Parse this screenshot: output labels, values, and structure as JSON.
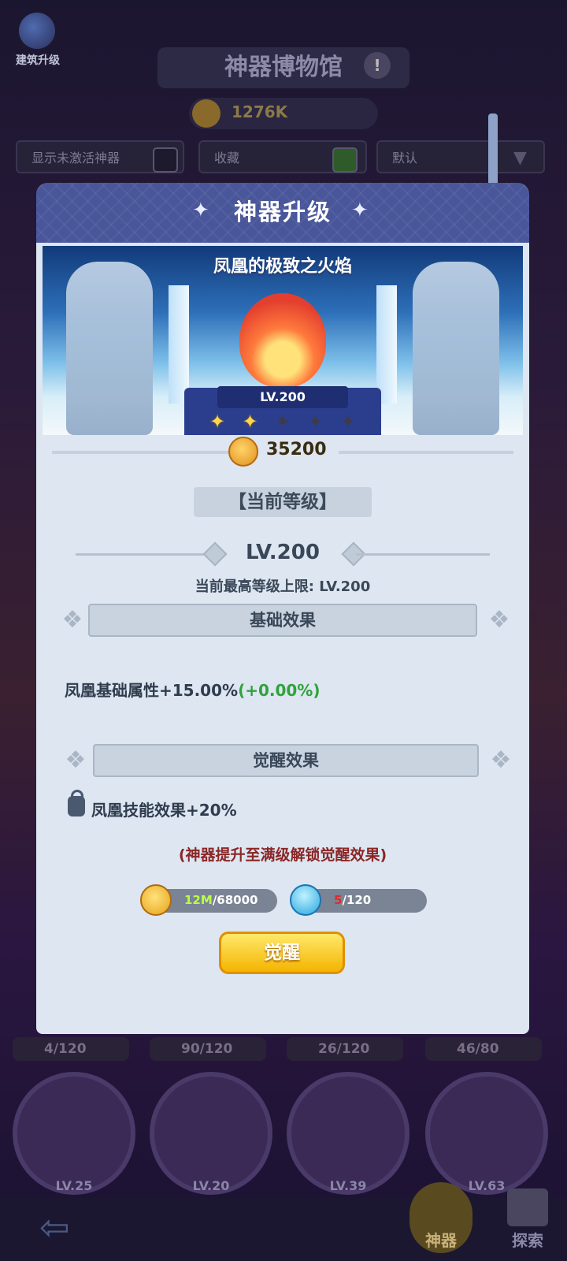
{
  "background": {
    "building_upgrade_label": "建筑升级",
    "museum_title": "神器博物馆",
    "info_symbol": "!",
    "currency_amount": "1276K",
    "filters": {
      "show_inactive_label": "显示未激活神器",
      "favorites_label": "收藏",
      "sort_label": "默认"
    },
    "progress_rows": [
      "4/120",
      "90/120",
      "26/120",
      "46/80"
    ],
    "artifact_slots": [
      "LV.25",
      "LV.20",
      "LV.39",
      "LV.63"
    ],
    "nav": {
      "artifact_label": "神器",
      "explore_label": "探索"
    }
  },
  "dialog": {
    "title": "神器升级",
    "artifact_name": "凤凰的极致之火焰",
    "level_plate": "LV.200",
    "stars": {
      "filled": 2,
      "total": 5
    },
    "upgrade_cost": "35200",
    "current_level_tag": "【当前等级】",
    "current_level": "LV.200",
    "max_level_text": "当前最高等级上限: LV.200",
    "base_effect_header": "基础效果",
    "base_effect_text": "凤凰基础属性+15.00%",
    "base_effect_bonus": "(+0.00%)",
    "awaken_effect_header": "觉醒效果",
    "awaken_effect_text": "凤凰技能效果+20%",
    "unlock_hint": "(神器提升至满级解锁觉醒效果)",
    "materials": [
      {
        "icon": "gold-coin-icon",
        "have": "12M",
        "need": "/68000"
      },
      {
        "icon": "blue-droplet-icon",
        "have": "5",
        "need": "/120"
      }
    ],
    "awaken_button": "觉醒"
  },
  "colors": {
    "header": "#49569a",
    "panel": "#dde6f1",
    "button": "#f4b400",
    "bonus_green": "#2fa33a",
    "hint_red": "#8a2626"
  }
}
